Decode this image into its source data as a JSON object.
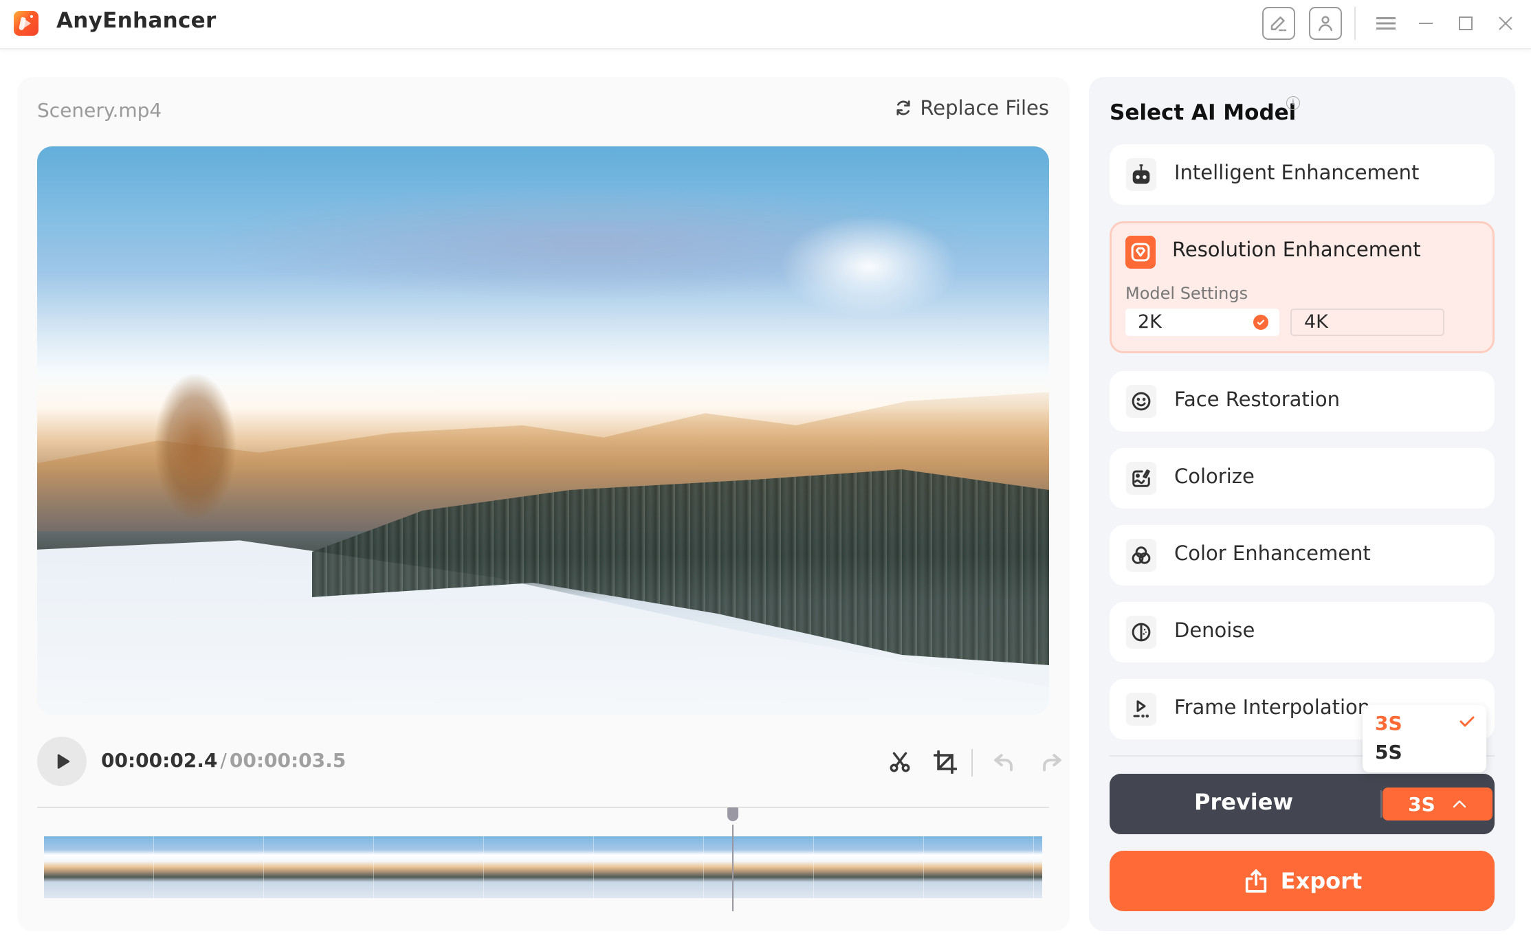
{
  "app": {
    "title": "AnyEnhancer",
    "brand_color": "#ff6a36"
  },
  "titlebar": {
    "icons": [
      "feedback-edit-icon",
      "account-icon",
      "menu-icon",
      "minimize-icon",
      "maximize-icon",
      "close-icon"
    ]
  },
  "editor": {
    "filename": "Scenery.mp4",
    "replace_label": "Replace Files",
    "current_time": "00:00:02.4",
    "time_separator": "/",
    "total_time": "00:00:03.5",
    "playhead_fraction": 0.69,
    "tools": [
      "cut-icon",
      "crop-icon",
      "undo-icon",
      "redo-icon"
    ],
    "thumbnail_count": 10
  },
  "models": {
    "title": "Select AI Model",
    "info_glyph": "i",
    "items": [
      {
        "label": "Intelligent Enhancement",
        "icon": "robot-icon"
      },
      {
        "label": "Resolution Enhancement",
        "icon": "diamond-icon",
        "selected": true
      },
      {
        "label": "Face Restoration",
        "icon": "smile-icon"
      },
      {
        "label": "Colorize",
        "icon": "colorize-icon"
      },
      {
        "label": "Color Enhancement",
        "icon": "color-circles-icon"
      },
      {
        "label": "Denoise",
        "icon": "denoise-icon"
      },
      {
        "label": "Frame Interpolation",
        "icon": "frame-play-icon"
      }
    ],
    "model_settings_label": "Model Settings",
    "resolution_options": [
      {
        "label": "2K",
        "selected": true
      },
      {
        "label": "4K",
        "selected": false
      }
    ]
  },
  "preview": {
    "label": "Preview",
    "duration_value": "3S",
    "duration_options": [
      {
        "label": "3S",
        "selected": true
      },
      {
        "label": "5S",
        "selected": false
      }
    ]
  },
  "export": {
    "label": "Export"
  }
}
